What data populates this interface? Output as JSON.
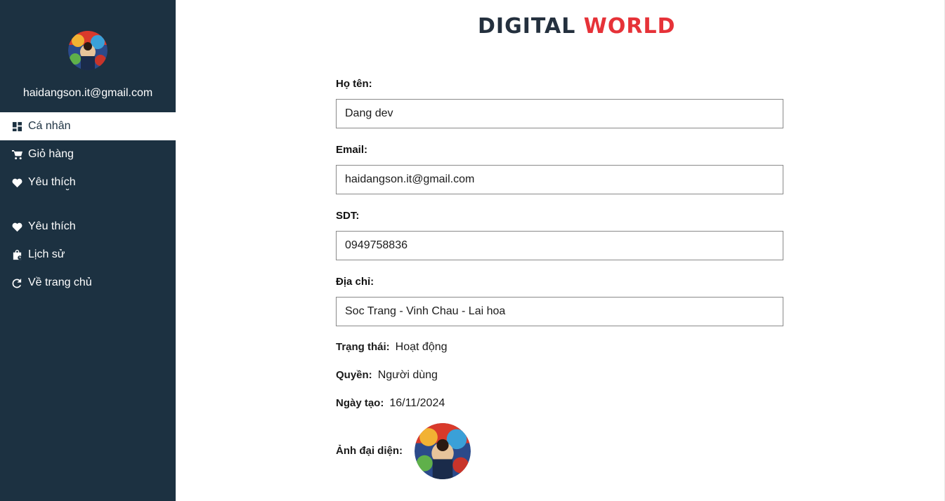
{
  "sidebar": {
    "email": "haidangson.it@gmail.com",
    "items": [
      {
        "label": "Cá nhân",
        "icon": "dashboard-icon",
        "active": true
      },
      {
        "label": "Giỏ hàng",
        "icon": "cart-icon"
      },
      {
        "label": "Yêu thích",
        "icon": "heart-icon"
      },
      {
        "label": "Yêu thích",
        "icon": "heart-icon"
      },
      {
        "label": "Lịch sử",
        "icon": "bag-history-icon"
      },
      {
        "label": "Về trang chủ",
        "icon": "redo-arrow-icon"
      }
    ]
  },
  "brand": {
    "part1": "DIGITAL",
    "part2": "WORLD",
    "color_dark": "#24303e",
    "color_red": "#e63238"
  },
  "form": {
    "name_label": "Họ tên:",
    "name_value": "Dang dev",
    "email_label": "Email:",
    "email_value": "haidangson.it@gmail.com",
    "phone_label": "SDT:",
    "phone_value": "0949758836",
    "address_label": "Địa chỉ:",
    "address_value": "Soc Trang - Vinh Chau - Lai hoa"
  },
  "info": {
    "status_label": "Trạng thái:",
    "status_value": "Hoạt động",
    "role_label": "Quyền:",
    "role_value": "Người dùng",
    "created_label": "Ngày tạo:",
    "created_value": "16/11/2024",
    "avatar_label": "Ảnh đại diện:"
  },
  "colors": {
    "sidebar_bg": "#1c3141",
    "accent": "#e63238"
  }
}
